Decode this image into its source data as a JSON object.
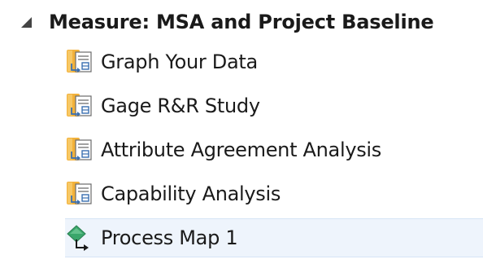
{
  "tree": {
    "phase": {
      "label": "Measure:  MSA and Project Baseline",
      "expanded": true,
      "toggle_icon": "collapse-triangle-icon"
    },
    "items": [
      {
        "label": "Graph Your Data",
        "icon": "form-document-icon",
        "selected": false
      },
      {
        "label": "Gage R&R Study",
        "icon": "form-document-icon",
        "selected": false
      },
      {
        "label": "Attribute Agreement Analysis",
        "icon": "form-document-icon",
        "selected": false
      },
      {
        "label": "Capability Analysis",
        "icon": "form-document-icon",
        "selected": false
      },
      {
        "label": "Process Map 1",
        "icon": "process-map-icon",
        "selected": true
      }
    ],
    "colors": {
      "folder_orange": "#f2b13a",
      "document_blue": "#3a6fb0",
      "process_green": "#3aa66b",
      "selection_bg": "#eef4fc",
      "selection_border": "#d6e4f5"
    }
  }
}
